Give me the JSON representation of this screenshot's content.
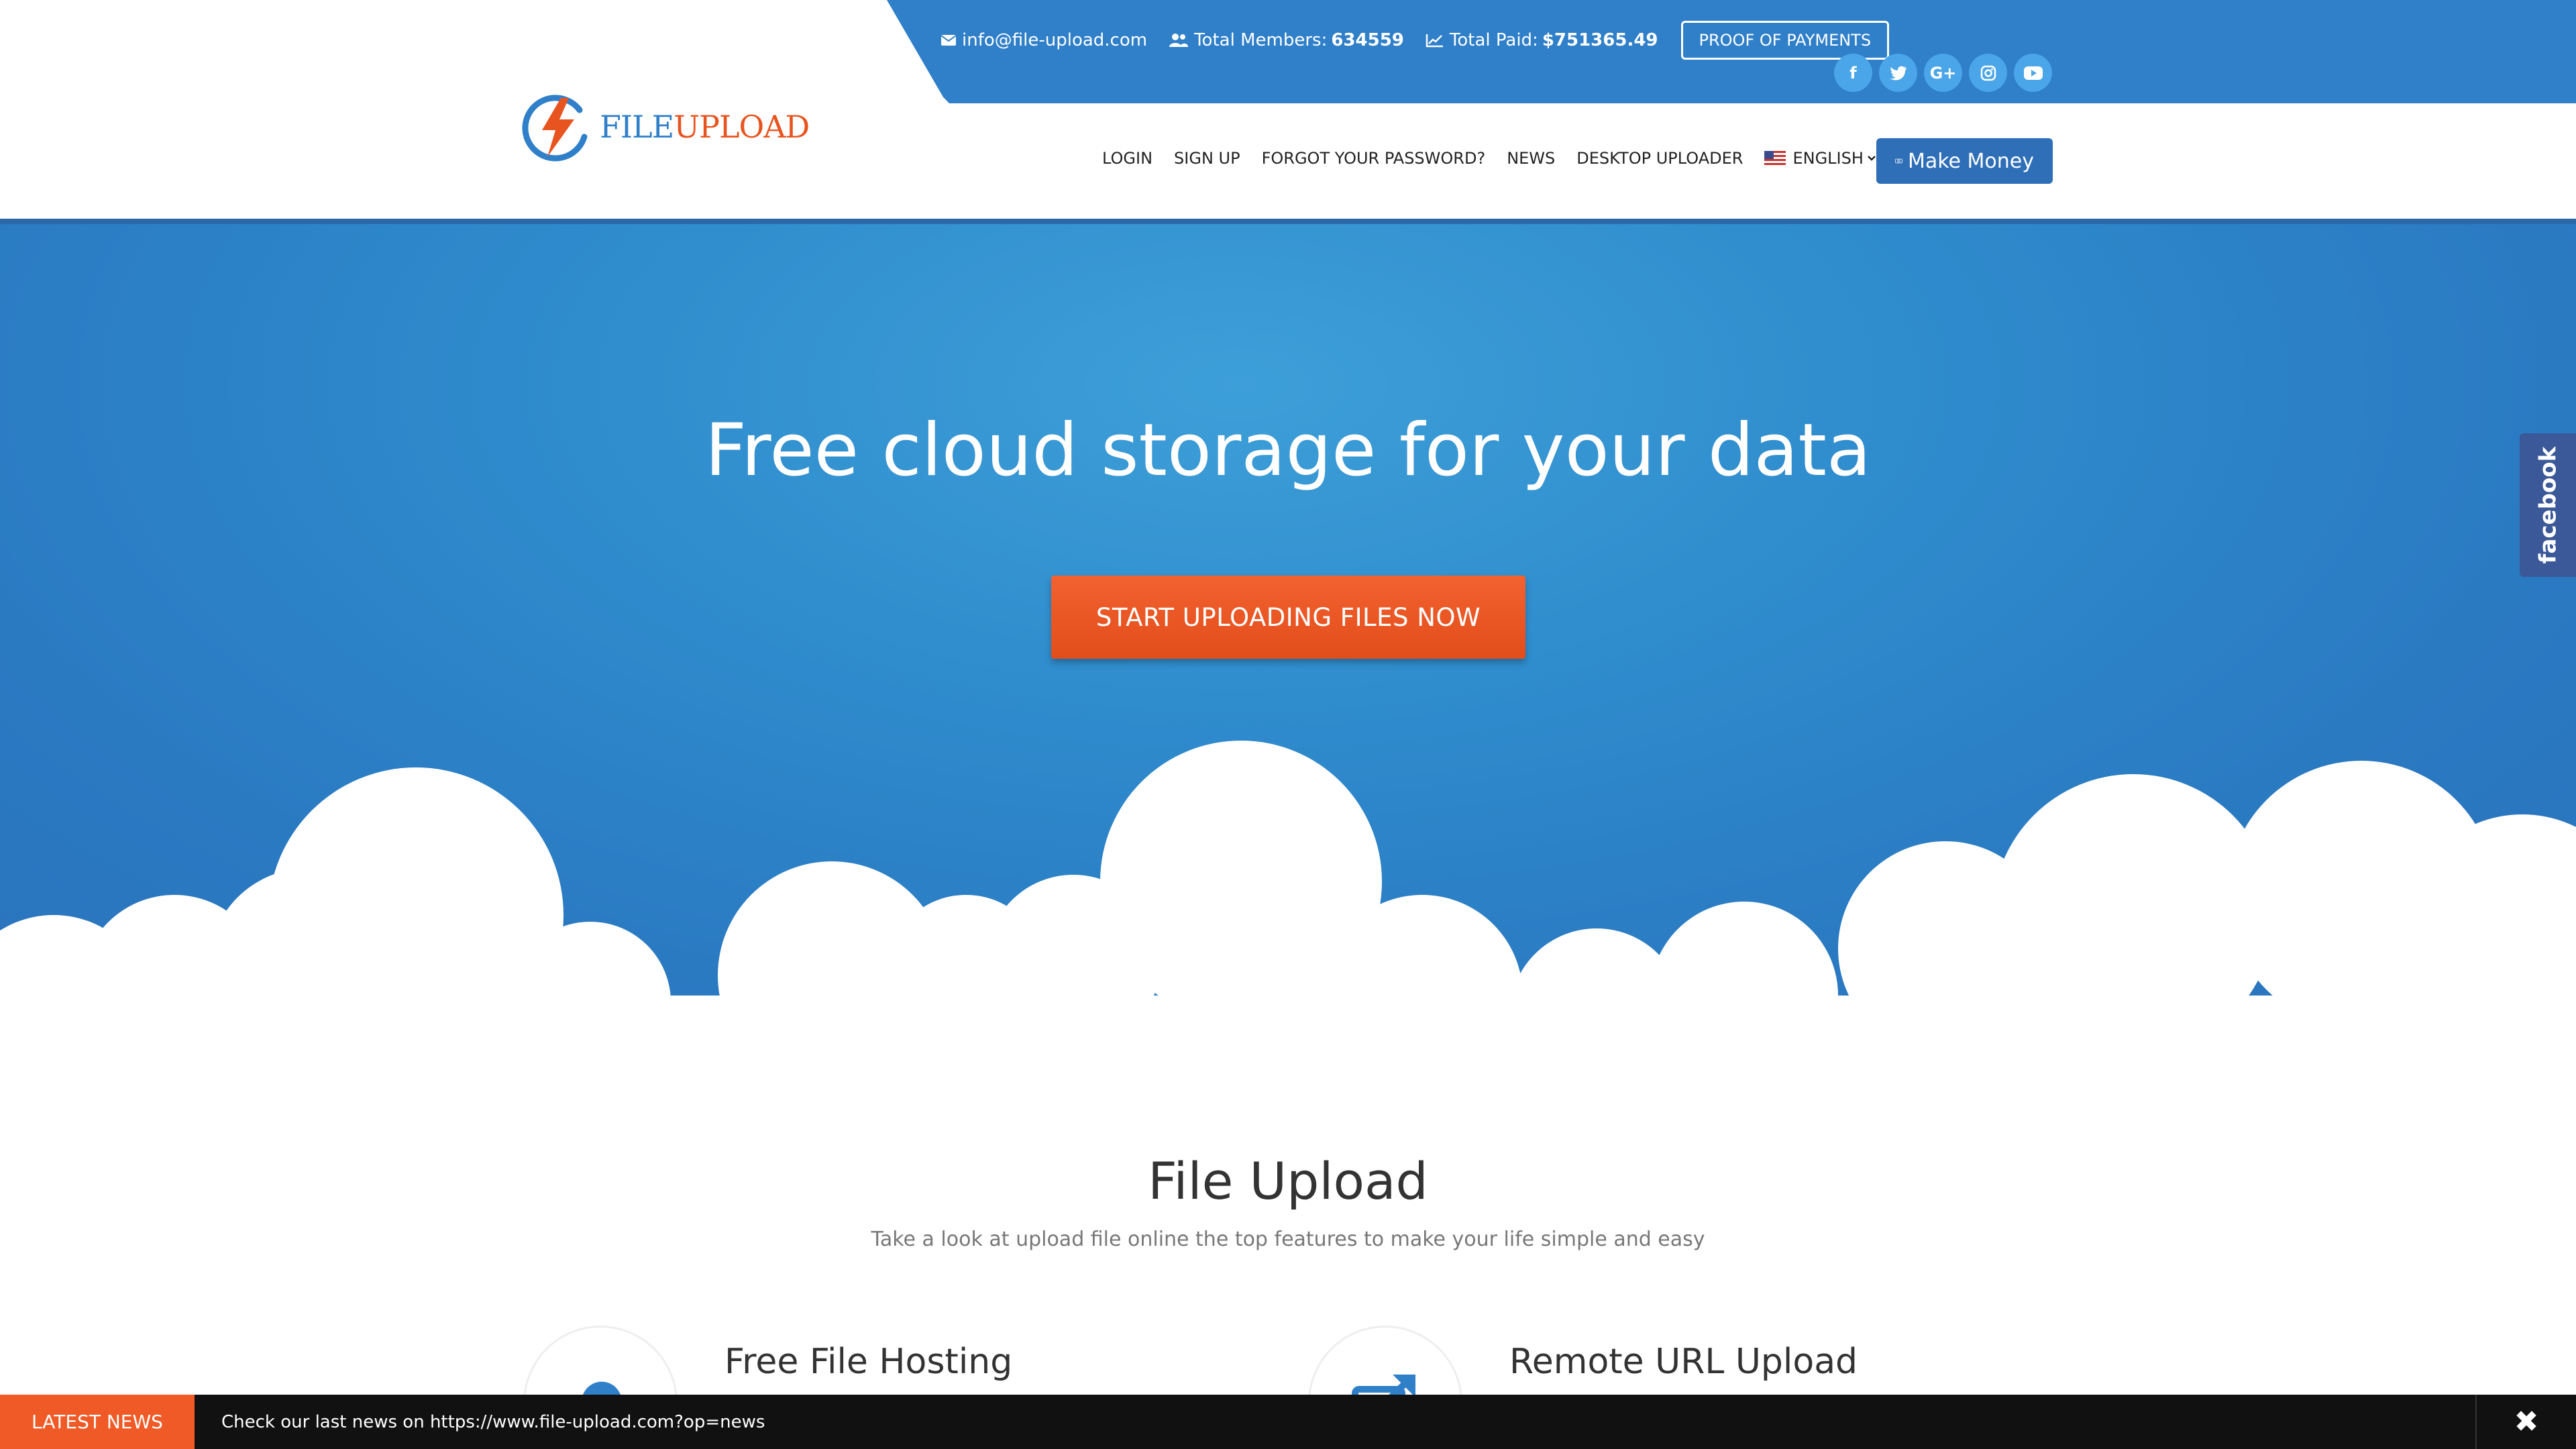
{
  "topbar": {
    "email": "info@file-upload.com",
    "members_label": "Total Members:",
    "members_value": "634559",
    "paid_label": "Total Paid:",
    "paid_value": "$751365.49",
    "proof_button": "PROOF OF PAYMENTS",
    "social": [
      "facebook-icon",
      "twitter-icon",
      "google-plus-icon",
      "instagram-icon",
      "youtube-icon"
    ]
  },
  "logo": {
    "part1": "FILE",
    "part2": "UPLOAD"
  },
  "nav": {
    "items": [
      "LOGIN",
      "SIGN UP",
      "FORGOT YOUR PASSWORD?",
      "NEWS",
      "DESKTOP UPLOADER"
    ],
    "language": "ENGLISH",
    "make_money": "Make Money"
  },
  "hero": {
    "title": "Free cloud storage for your data",
    "cta": "START UPLOADING FILES NOW"
  },
  "side_tab": "facebook",
  "features": {
    "title": "File Upload",
    "subtitle": "Take a look at upload file online the top features to make your life simple and easy",
    "items": [
      {
        "title": "Free File Hosting",
        "icon": "cloud-upload-icon"
      },
      {
        "title": "Remote URL Upload",
        "icon": "external-link-icon"
      }
    ]
  },
  "newsbar": {
    "tag": "LATEST NEWS",
    "message": "Check our last news on https://www.file-upload.com?op=news",
    "close_icon": "close-icon"
  },
  "colors": {
    "primary": "#2f7fc9",
    "accent": "#f05a26",
    "news_bg": "#111111"
  }
}
